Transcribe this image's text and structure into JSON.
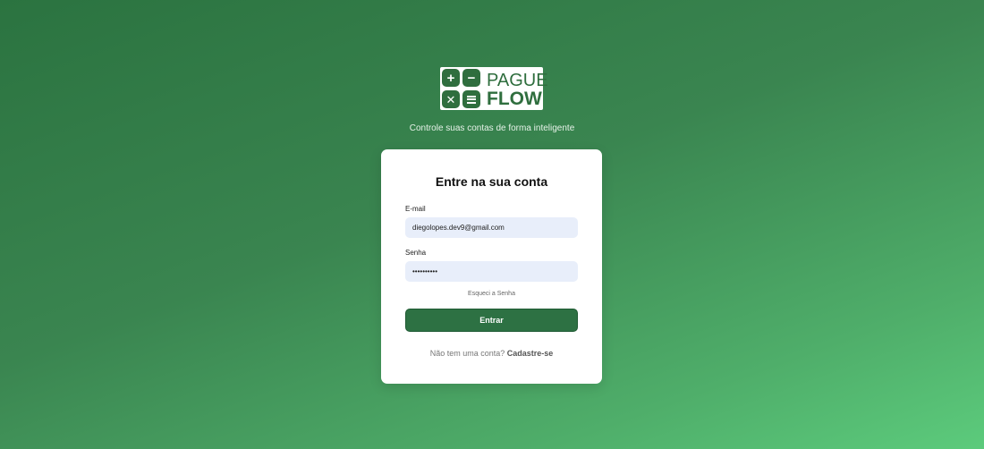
{
  "brand": {
    "logo_word_top": "PAGUE",
    "logo_word_bottom": "FLOW",
    "logo_icons": [
      "plus-icon",
      "minus-icon",
      "times-icon",
      "equals-icon"
    ],
    "tagline": "Controle suas contas de forma inteligente"
  },
  "login": {
    "title": "Entre na sua conta",
    "email_label": "E-mail",
    "email_value": "diegolopes.dev9@gmail.com",
    "password_label": "Senha",
    "password_value": "••••••••••",
    "forgot_label": "Esqueci a Senha",
    "submit_label": "Entrar",
    "signup_prompt": "Não tem uma conta?",
    "signup_link": "Cadastre-se"
  },
  "colors": {
    "brand_green": "#2f6e3e",
    "button_green": "#2d7143",
    "input_bg": "#e8eefa"
  }
}
